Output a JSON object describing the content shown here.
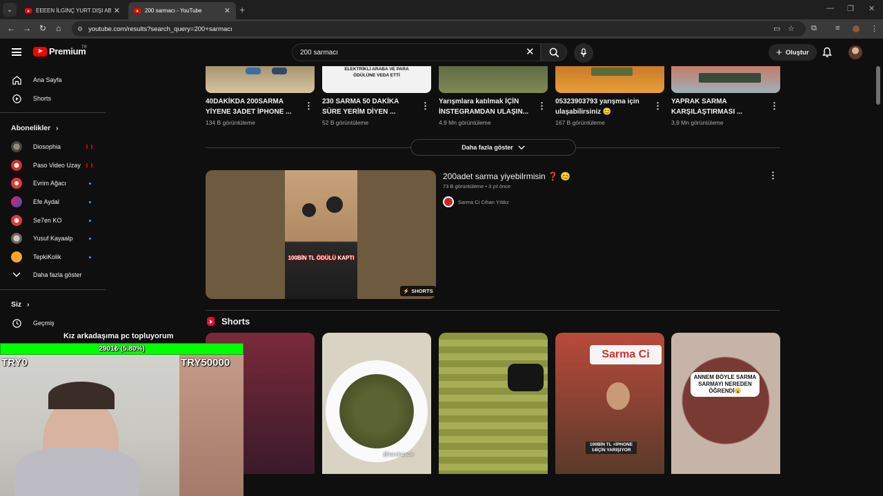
{
  "browser": {
    "tabs": [
      {
        "title": "EEEEN İLGİNÇ YURT DIŞI ABUR"
      },
      {
        "title": "200 sarmacı - YouTube"
      }
    ],
    "url": "youtube.com/results?search_query=200+sarmacı"
  },
  "masthead": {
    "logo_text": "Premium",
    "logo_country": "TR",
    "search_query": "200 sarmacı",
    "create_label": "Oluştur"
  },
  "sidebar": {
    "main": [
      {
        "label": "Ana Sayfa",
        "icon": "home-icon"
      },
      {
        "label": "Shorts",
        "icon": "shorts-icon"
      }
    ],
    "subscriptions_heading": "Abonelikler",
    "subscriptions": [
      {
        "label": "Diosophia",
        "status": "live"
      },
      {
        "label": "Paso Video Uzay",
        "status": "live"
      },
      {
        "label": "Evrim Ağacı",
        "status": "new"
      },
      {
        "label": "Efe Aydal",
        "status": "new"
      },
      {
        "label": "Se7en KO",
        "status": "new"
      },
      {
        "label": "Yusuf Kayaalp",
        "status": "new"
      },
      {
        "label": "TepkiKolik",
        "status": "new"
      }
    ],
    "show_more": "Daha fazla göster",
    "you_heading": "Siz",
    "you_items": [
      {
        "label": "Geçmiş",
        "icon": "history-icon"
      }
    ]
  },
  "results_row": [
    {
      "title": "40DAKİKDA 200SARMA YİYENE 3ADET İPHONE ...",
      "views": "134 B görüntüleme",
      "thumb_caption": ""
    },
    {
      "title": "230 SARMA 50 DAKİKA SÜRE YERİM DİYEN ...",
      "views": "52 B görüntüleme",
      "thumb_caption": "ELEKTRİKLİ ARABA VE PARA ÖDÜLÜNE VEDA ETTİ"
    },
    {
      "title": "Yarışmlara katılmak İÇİN İNSTEGRAMDAN ULAŞIN...",
      "views": "4,9 Mn görüntüleme",
      "thumb_caption": ""
    },
    {
      "title": "05323903793 yarışma için ulaşabilirsiniz 😊",
      "views": "167 B görüntüleme",
      "thumb_caption": ""
    },
    {
      "title": "YAPRAK SARMA KARŞILAŞTIRMASI ...",
      "views": "3,9 Mn görüntüleme",
      "thumb_caption": ""
    }
  ],
  "show_more_button": "Daha fazla göster",
  "featured": {
    "title": "200adet sarma yiyebilrmisin ❓ 😊",
    "meta": "73 B görüntüleme • 3 yıl önce",
    "channel": "Sarma Ci Cihan Yıldız",
    "thumb_caption": "100BİN TL ÖDÜLÜ KAPTI",
    "badge": "SHORTS"
  },
  "shorts_section": {
    "heading": "Shorts",
    "cards": [
      {
        "caption": ""
      },
      {
        "caption": "@tarcinzade"
      },
      {
        "caption": ""
      },
      {
        "caption": "100BİN TL +İPHONE 14İÇİN YARIŞIYOR",
        "brand": "Sarma Ci"
      },
      {
        "caption": "ANNEM BÖYLE SARMA SARMAYI NEREDEN ÖĞRENDİ😮"
      }
    ]
  },
  "stream_overlay": {
    "goal_title": "Kız arkadaşıma pc topluyorum",
    "goal_progress": "2901₺ (5.80%)",
    "goal_fraction": 0.058,
    "goal_min": "TRY0",
    "goal_max": "TRY50000"
  },
  "colors": {
    "background": "#0f0f0f",
    "accent_red": "#ff0000",
    "goal_green": "#00ff00",
    "link_blue": "#3ea6ff"
  }
}
